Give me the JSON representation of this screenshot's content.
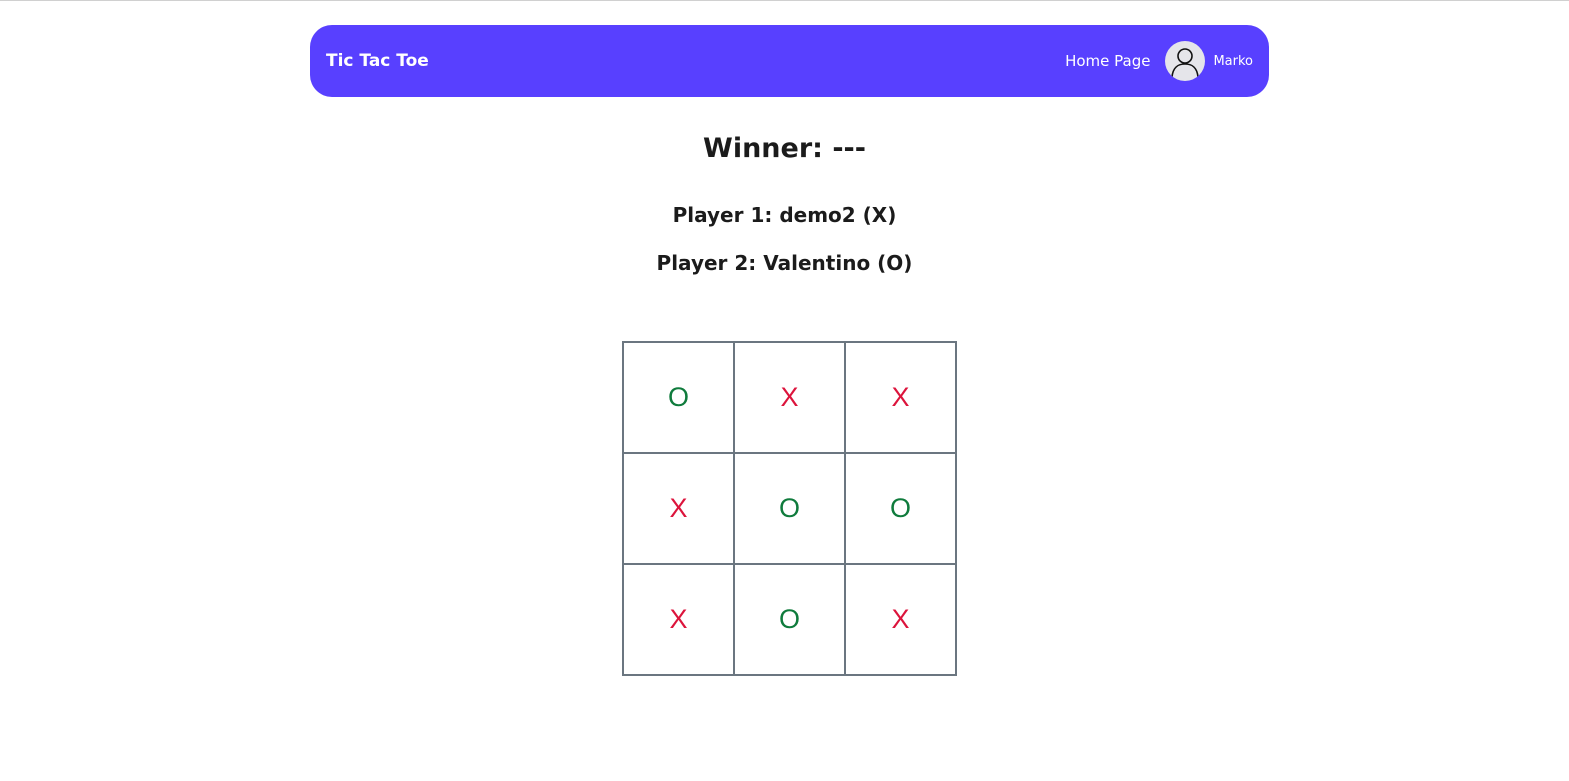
{
  "colors": {
    "navbar_bg": "#5840ff",
    "x_mark": "#dc143c",
    "o_mark": "#0f7b3c"
  },
  "navbar": {
    "brand": "Tic Tac Toe",
    "home_link": "Home Page",
    "avatar_icon": "user-avatar-icon",
    "username": "Marko"
  },
  "game": {
    "winner_text": "Winner: ---",
    "player1_text": "Player 1: demo2 (X)",
    "player2_text": "Player 2: Valentino (O)",
    "board": [
      [
        "O",
        "X",
        "X"
      ],
      [
        "X",
        "O",
        "O"
      ],
      [
        "X",
        "O",
        "X"
      ]
    ]
  }
}
